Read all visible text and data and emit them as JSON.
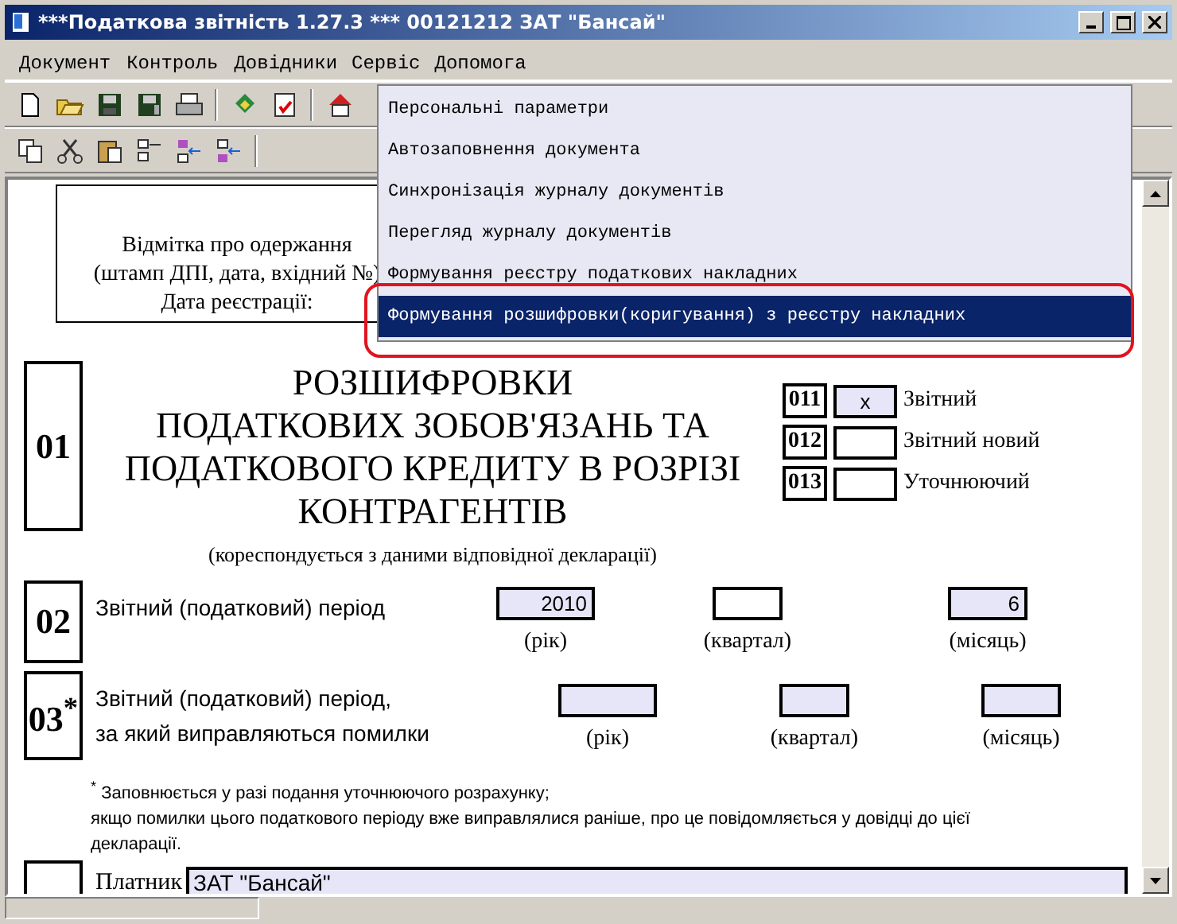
{
  "window": {
    "title": "***Податкова звітність 1.27.3 *** 00121212 ЗАТ \"Бансай\""
  },
  "menu": [
    {
      "label": "Документ",
      "open": false
    },
    {
      "label": "Контроль",
      "open": false
    },
    {
      "label": "Довідники",
      "open": false
    },
    {
      "label": "Сервіс",
      "open": true
    },
    {
      "label": "Допомога",
      "open": false
    }
  ],
  "dropdown": [
    {
      "label": "Персональні параметри",
      "selected": false
    },
    {
      "label": "Автозаповнення документа",
      "selected": false
    },
    {
      "label": "Синхронізація журналу документів",
      "selected": false
    },
    {
      "label": "Перегляд журналу документів",
      "selected": false
    },
    {
      "label": "Формування реєстру податкових накладних",
      "selected": false
    },
    {
      "label": "Формування розшифровки(коригування) з реєстру накладних",
      "selected": true
    }
  ],
  "stamp_box": [
    "Відмітка про одержання",
    "(штамп ДПІ, дата, вхідний №)",
    "Дата реєстрації:"
  ],
  "section_01": {
    "number": "01",
    "title": [
      "РОЗШИФРОВКИ",
      "ПОДАТКОВИХ ЗОБОВ'ЯЗАНЬ ТА",
      "ПОДАТКОВОГО КРЕДИТУ В РОЗРІЗІ",
      "КОНТРАГЕНТІВ"
    ],
    "note": "(кореспондується з даними відповідної декларації)",
    "options": [
      {
        "code": "011",
        "value": "x",
        "label": "Звітний",
        "filled": true
      },
      {
        "code": "012",
        "label": "Звітний новий",
        "filled": false
      },
      {
        "code": "013",
        "label": "Уточнюючий",
        "filled": false
      }
    ]
  },
  "section_02": {
    "number": "02",
    "label": "Звітний (податковий) період",
    "fields": [
      {
        "value": "2010",
        "caption": "(рік)",
        "filled": true
      },
      {
        "caption": "(квартал)",
        "filled": false
      },
      {
        "value": "6",
        "caption": "(місяць)",
        "filled": true
      }
    ]
  },
  "section_03": {
    "number": "03$^{*}$",
    "label": [
      "Звітний (податковий) період,",
      "за який виправляються помилки"
    ],
    "fields": [
      {
        "caption": "(рік)",
        "filled": true
      },
      {
        "caption": "(квартал)",
        "filled": true
      },
      {
        "caption": "(місяць)",
        "filled": true
      }
    ]
  },
  "footnote": [
    "$^{*}$ Заповнюється у разі подання уточнюючого розрахунку;",
    "якщо помилки цього податкового періоду вже виправлялися раніше, про це повідомляється у довідці до цієї",
    "декларації."
  ],
  "section_04": {
    "label": "Платник",
    "value": "ЗАТ \"Бансай\""
  }
}
